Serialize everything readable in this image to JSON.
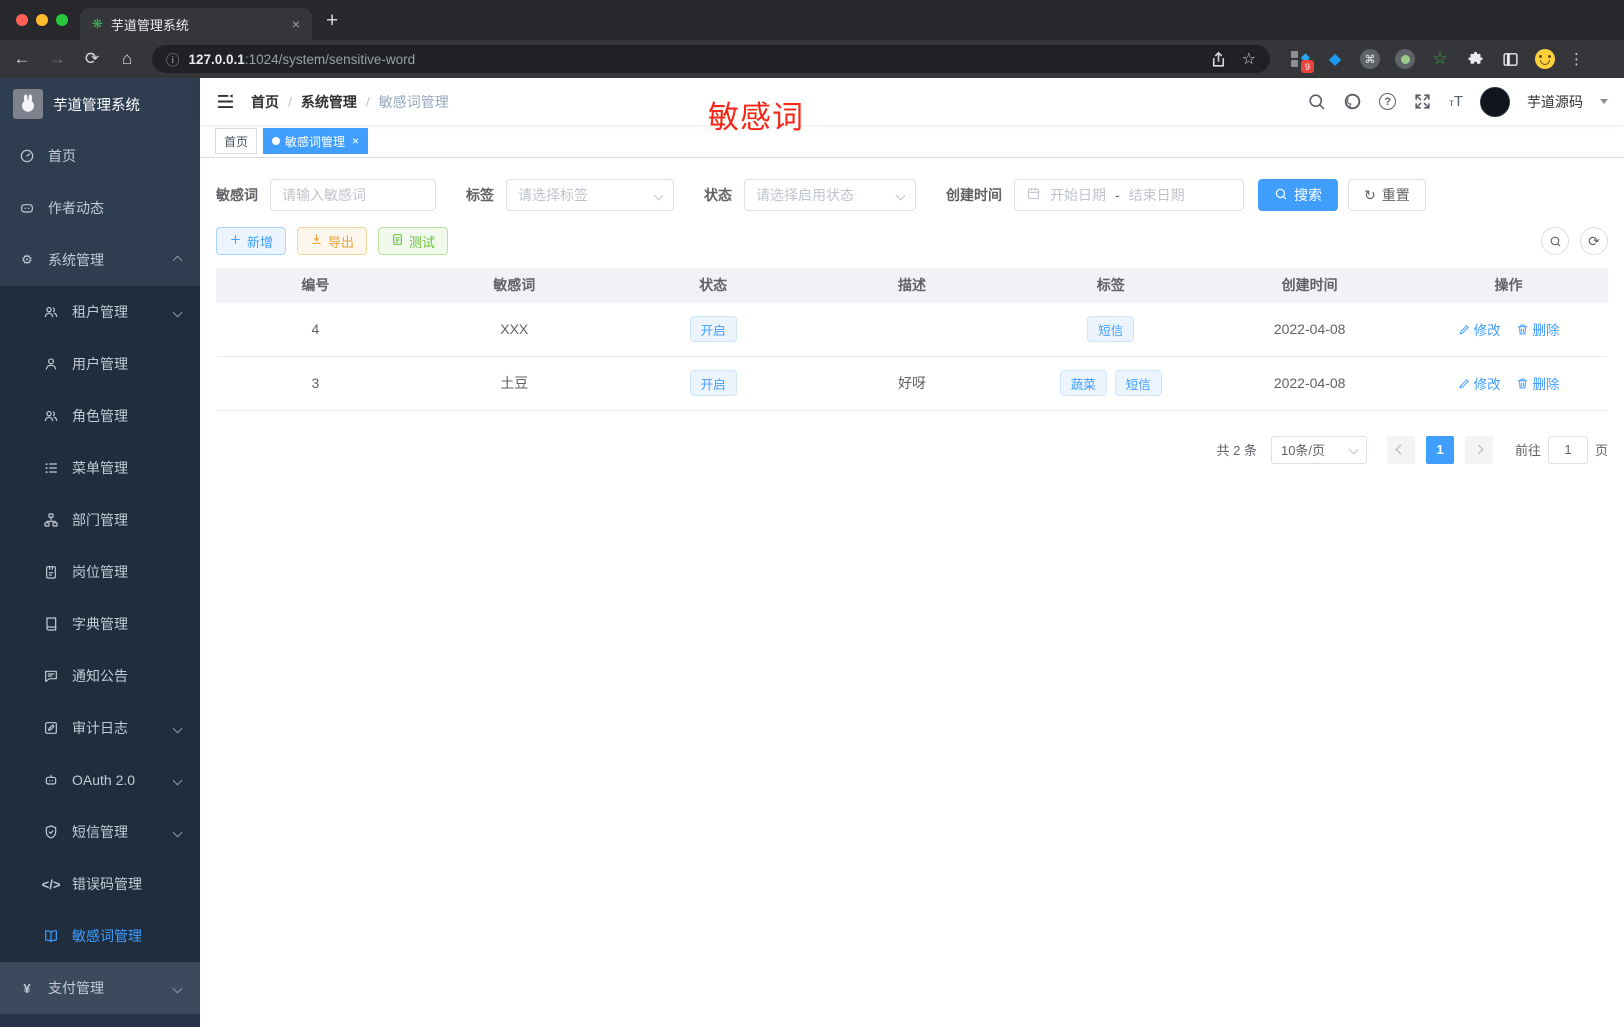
{
  "browser": {
    "tab_title": "芋道管理系统",
    "url_host": "127.0.0.1",
    "url_path": ":1024/system/sensitive-word",
    "ext_badge": "9"
  },
  "sidebar": {
    "logo_title": "芋道管理系统",
    "items": [
      {
        "label": "首页"
      },
      {
        "label": "作者动态"
      },
      {
        "label": "系统管理"
      }
    ],
    "sub": [
      {
        "label": "租户管理"
      },
      {
        "label": "用户管理"
      },
      {
        "label": "角色管理"
      },
      {
        "label": "菜单管理"
      },
      {
        "label": "部门管理"
      },
      {
        "label": "岗位管理"
      },
      {
        "label": "字典管理"
      },
      {
        "label": "通知公告"
      },
      {
        "label": "审计日志"
      },
      {
        "label": "OAuth 2.0"
      },
      {
        "label": "短信管理"
      },
      {
        "label": "错误码管理"
      },
      {
        "label": "敏感词管理"
      }
    ],
    "bottom": {
      "label": "支付管理"
    }
  },
  "navbar": {
    "breadcrumb": {
      "items": [
        "首页",
        "系统管理",
        "敏感词管理"
      ],
      "separator": "/"
    },
    "username": "芋道源码"
  },
  "watermark": "敏感词",
  "tags": [
    {
      "label": "首页"
    },
    {
      "label": "敏感词管理"
    }
  ],
  "filters": {
    "keyword_label": "敏感词",
    "keyword_placeholder": "请输入敏感词",
    "tag_label": "标签",
    "tag_placeholder": "请选择标签",
    "status_label": "状态",
    "status_placeholder": "请选择启用状态",
    "date_label": "创建时间",
    "date_start": "开始日期",
    "date_separator": "-",
    "date_end": "结束日期",
    "search_label": "搜索",
    "reset_label": "重置"
  },
  "actions": {
    "add": "新增",
    "export": "导出",
    "test": "测试"
  },
  "table": {
    "headers": [
      "编号",
      "敏感词",
      "状态",
      "描述",
      "标签",
      "创建时间",
      "操作"
    ],
    "rows": [
      {
        "id": "4",
        "word": "XXX",
        "status": "开启",
        "desc": "",
        "tags": [
          "短信"
        ],
        "created": "2022-04-08"
      },
      {
        "id": "3",
        "word": "土豆",
        "status": "开启",
        "desc": "好呀",
        "tags": [
          "蔬菜",
          "短信"
        ],
        "created": "2022-04-08"
      }
    ],
    "edit_label": "修改",
    "delete_label": "删除"
  },
  "pagination": {
    "total": "共 2 条",
    "size": "10条/页",
    "page": "1",
    "goto_label": "前往",
    "goto_value": "1",
    "unit_label": "页"
  },
  "colors": {
    "accent": "#409eff",
    "watermark_red": "#f62717",
    "sidebar_bg": "#2f3d50",
    "submenu_bg": "#1f2d3d"
  }
}
